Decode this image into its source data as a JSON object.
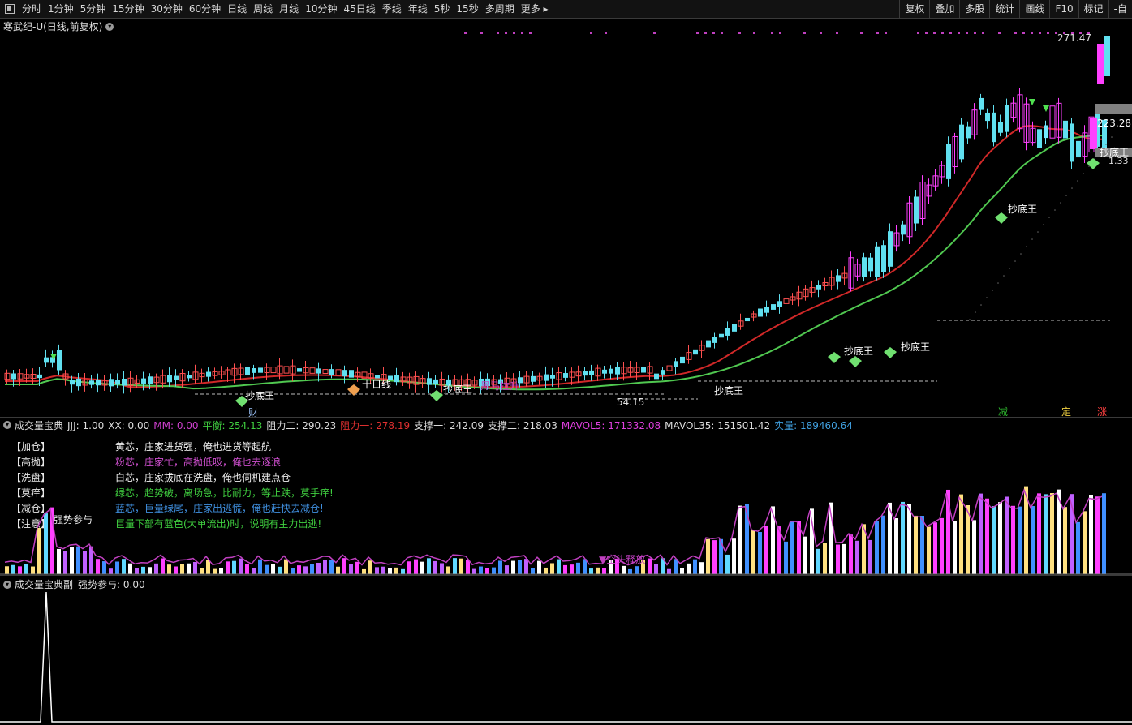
{
  "toolbar": {
    "periods": [
      "分时",
      "1分钟",
      "5分钟",
      "15分钟",
      "30分钟",
      "60分钟",
      "日线",
      "周线",
      "月线",
      "10分钟",
      "45日线",
      "季线",
      "年线",
      "5秒",
      "15秒",
      "多周期",
      "更多"
    ],
    "actions": [
      "复权",
      "叠加",
      "多股",
      "统计",
      "画线",
      "F10",
      "标记",
      "-自"
    ]
  },
  "stock_title": "寒武纪-U(日线,前复权)",
  "price_labels": {
    "high": "271.47",
    "mid": "223.28",
    "low": "54.15",
    "right_small": "1.33"
  },
  "kline_annotations": {
    "chaodi": "抄底王",
    "heima": "黑马拉升",
    "shiri": "十日线",
    "cai": "财",
    "jian": "减",
    "ding": "定",
    "zhang": "涨"
  },
  "indicator": {
    "name": "成交量宝典",
    "values": [
      {
        "label": "JJJ: 1.00",
        "color": "#dddddd"
      },
      {
        "label": "XX: 0.00",
        "color": "#dddddd"
      },
      {
        "label": "MM: 0.00",
        "color": "#d040d0"
      },
      {
        "label": "平衡: 254.13",
        "color": "#40d040"
      },
      {
        "label": "阻力二: 290.23",
        "color": "#dddddd"
      },
      {
        "label": "阻力一: 278.19",
        "color": "#e03030"
      },
      {
        "label": "支撑一: 242.09",
        "color": "#dddddd"
      },
      {
        "label": "支撑二: 218.03",
        "color": "#dddddd"
      },
      {
        "label": "MAVOL5: 171332.08",
        "color": "#e040e0"
      },
      {
        "label": "MAVOL35: 151501.42",
        "color": "#dddddd"
      },
      {
        "label": "实量: 189460.64",
        "color": "#40a0e0"
      }
    ],
    "legend": [
      {
        "tag": "【加仓】",
        "text": "黄芯，庄家进货强，俺也进货等起航",
        "color": "#f0f0f0"
      },
      {
        "tag": "【高抛】",
        "text": "粉芯，庄家忙，高抛低吸，俺也去逐浪",
        "color": "#d050d0"
      },
      {
        "tag": "【洗盘】",
        "text": "白芯，庄家拔底在洗盘，俺也伺机建点仓",
        "color": "#f0f0f0"
      },
      {
        "tag": "【莫痒】",
        "text": "绿芯，趋势破，离场急，比耐力，等止跌，莫手痒!",
        "color": "#40d040"
      },
      {
        "tag": "【减仓】",
        "text": "蓝芯，巨量绿尾，庄家出逃慌，俺也赶快去减仓!",
        "color": "#4090e0"
      },
      {
        "tag": "【注意】",
        "text": "巨量下部有蓝色(大单流出)时，说明有主力出逃!",
        "color": "#40d040"
      }
    ],
    "qiangshi": "强势参与",
    "kongtou": "▼空头释放"
  },
  "sub_indicator": {
    "name": "成交量宝典副",
    "value": "强势参与: 0.00"
  }
}
